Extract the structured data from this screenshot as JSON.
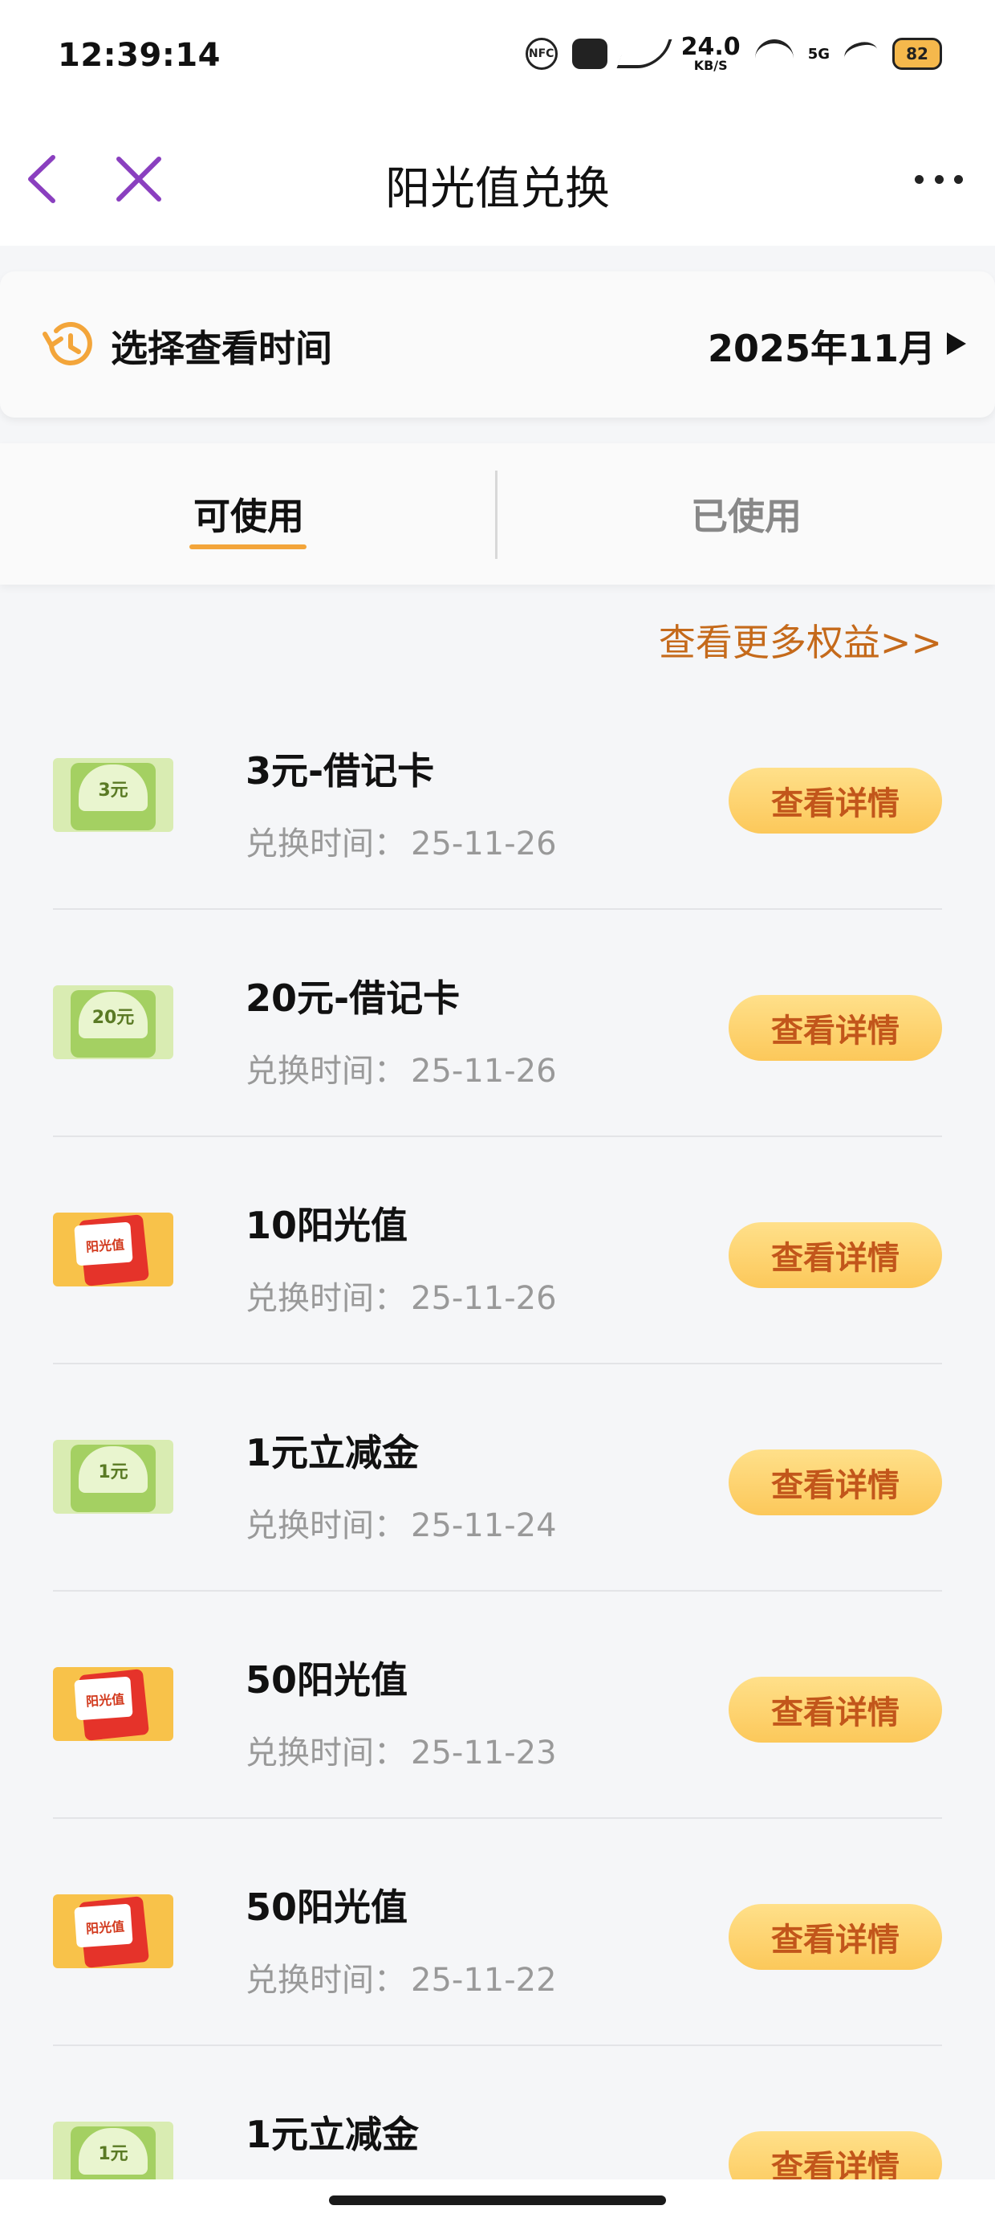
{
  "status_bar": {
    "time": "12:39:14",
    "speed_value": "24.0",
    "speed_unit": "KB/S",
    "network": "5G",
    "battery": "82",
    "icons": [
      "nfc-icon",
      "cat-face-icon",
      "mute-icon",
      "speed-icon",
      "wifi-icon",
      "5g-signal-icon",
      "swirl-icon",
      "battery-icon"
    ]
  },
  "nav": {
    "title": "阳光值兑换",
    "icons": [
      "back-icon",
      "close-icon",
      "more-icon"
    ],
    "accent": "#8a3fbf"
  },
  "time_selector": {
    "label": "选择查看时间",
    "value": "2025年11月",
    "icon": "history-clock-icon"
  },
  "tabs": [
    {
      "label": "可使用",
      "active": true
    },
    {
      "label": "已使用",
      "active": false
    }
  ],
  "more_link": "查看更多权益>>",
  "date_prefix": "兑换时间：",
  "items": [
    {
      "title": "3元-借记卡",
      "date": "25-11-26",
      "thumb": "green",
      "thumb_amount": "3元",
      "button": "查看详情"
    },
    {
      "title": "20元-借记卡",
      "date": "25-11-26",
      "thumb": "green",
      "thumb_amount": "20元",
      "button": "查看详情"
    },
    {
      "title": "10阳光值",
      "date": "25-11-26",
      "thumb": "orange",
      "thumb_label": "阳光值",
      "button": "查看详情"
    },
    {
      "title": "1元立减金",
      "date": "25-11-24",
      "thumb": "green",
      "thumb_amount": "1元",
      "button": "查看详情"
    },
    {
      "title": "50阳光值",
      "date": "25-11-23",
      "thumb": "orange",
      "thumb_label": "阳光值",
      "button": "查看详情"
    },
    {
      "title": "50阳光值",
      "date": "25-11-22",
      "thumb": "orange",
      "thumb_label": "阳光值",
      "button": "查看详情"
    },
    {
      "title": "1元立减金",
      "date": "",
      "thumb": "green",
      "thumb_amount": "1元",
      "button": "查看详情"
    }
  ],
  "colors": {
    "accent_orange": "#f3a53a",
    "link_orange": "#c56a1b",
    "button_gradient_top": "#ffe08a",
    "button_gradient_bottom": "#fcc85a",
    "button_text": "#c2561b"
  }
}
